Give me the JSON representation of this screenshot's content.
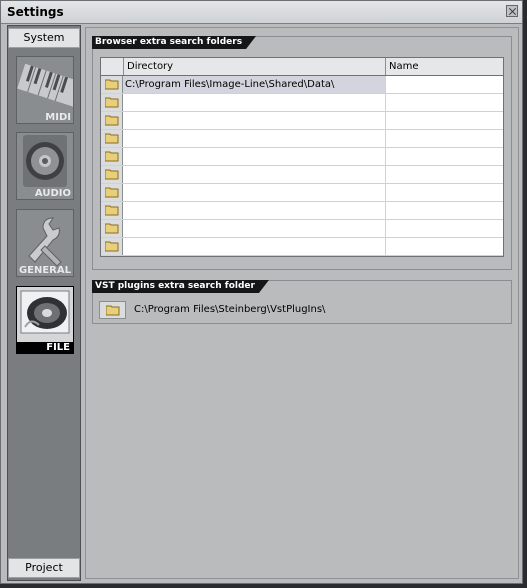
{
  "window": {
    "title": "Settings"
  },
  "sidebar": {
    "top_tab": "System",
    "bottom_tab": "Project",
    "categories": [
      {
        "label": "MIDI",
        "icon": "midi-keyboard-icon",
        "selected": false
      },
      {
        "label": "AUDIO",
        "icon": "speaker-icon",
        "selected": false
      },
      {
        "label": "GENERAL",
        "icon": "wrench-icon",
        "selected": false
      },
      {
        "label": "FILE",
        "icon": "disc-icon",
        "selected": true
      }
    ]
  },
  "browser_folders": {
    "title": "Browser extra search folders",
    "columns": [
      "Directory",
      "Name"
    ],
    "rows": [
      {
        "directory": "C:\\Program Files\\Image-Line\\Shared\\Data\\",
        "name": ""
      },
      {
        "directory": "",
        "name": ""
      },
      {
        "directory": "",
        "name": ""
      },
      {
        "directory": "",
        "name": ""
      },
      {
        "directory": "",
        "name": ""
      },
      {
        "directory": "",
        "name": ""
      },
      {
        "directory": "",
        "name": ""
      },
      {
        "directory": "",
        "name": ""
      },
      {
        "directory": "",
        "name": ""
      },
      {
        "directory": "",
        "name": ""
      }
    ]
  },
  "vst_folder": {
    "title": "VST plugins extra search folder",
    "path": "C:\\Program Files\\Steinberg\\VstPlugIns\\"
  },
  "colors": {
    "window_bg": "#b9bbbd",
    "sidebar_bg": "#7a7d80",
    "group_title_bg": "#151617",
    "selected_row": "#d3d4dd"
  }
}
